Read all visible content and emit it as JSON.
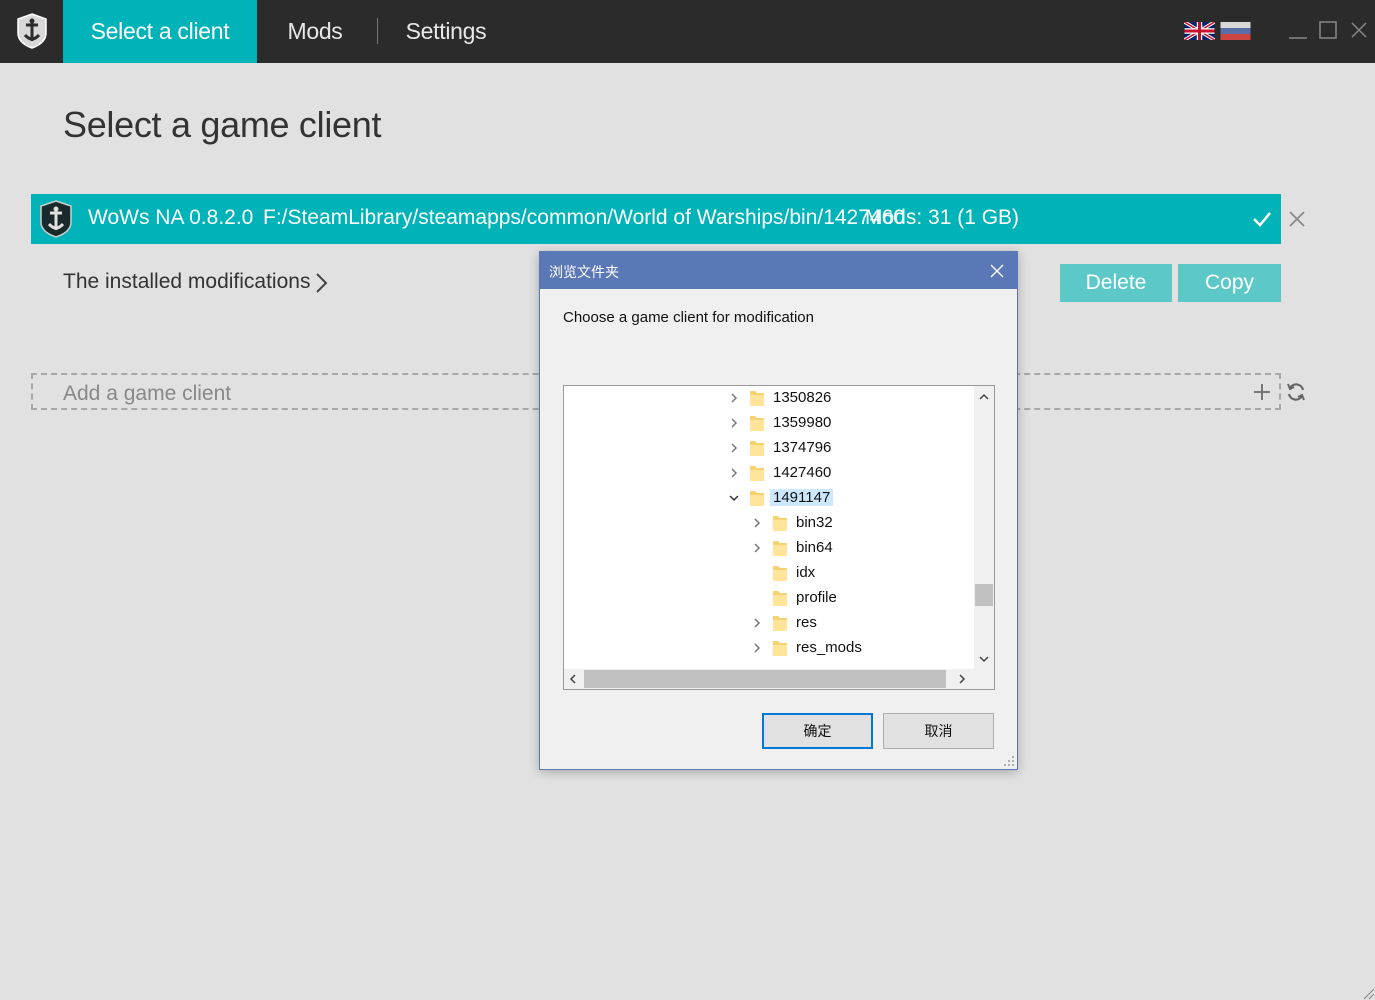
{
  "topbar": {
    "tabs": [
      "Select a client",
      "Mods",
      "Settings"
    ],
    "languages": [
      "English",
      "Russian"
    ]
  },
  "main": {
    "title": "Select a game client",
    "client": {
      "name": "WoWs NA 0.8.2.0",
      "path": "F:/SteamLibrary/steamapps/common/World of Warships/bin/1427460",
      "mods": "Mods: 31 (1 GB)"
    },
    "installed_label": "The installed modifications",
    "delete_label": "Delete",
    "copy_label": "Copy",
    "add_label": "Add a game client"
  },
  "dialog": {
    "title": "浏览文件夹",
    "description": "Choose a game client for modification",
    "tree": [
      {
        "label": "1350826",
        "expandable": true
      },
      {
        "label": "1359980",
        "expandable": true
      },
      {
        "label": "1374796",
        "expandable": true
      },
      {
        "label": "1427460",
        "expandable": true
      },
      {
        "label": "1491147",
        "expandable": true,
        "expanded": true,
        "selected": true
      },
      {
        "label": "bin32",
        "expandable": true,
        "child": true
      },
      {
        "label": "bin64",
        "expandable": true,
        "child": true
      },
      {
        "label": "idx",
        "expandable": false,
        "child": true
      },
      {
        "label": "profile",
        "expandable": false,
        "child": true
      },
      {
        "label": "res",
        "expandable": true,
        "child": true
      },
      {
        "label": "res_mods",
        "expandable": true,
        "child": true
      }
    ],
    "ok_label": "确定",
    "cancel_label": "取消"
  },
  "colors": {
    "accent": "#00b3b9",
    "dialog_title": "#5a78b5"
  }
}
